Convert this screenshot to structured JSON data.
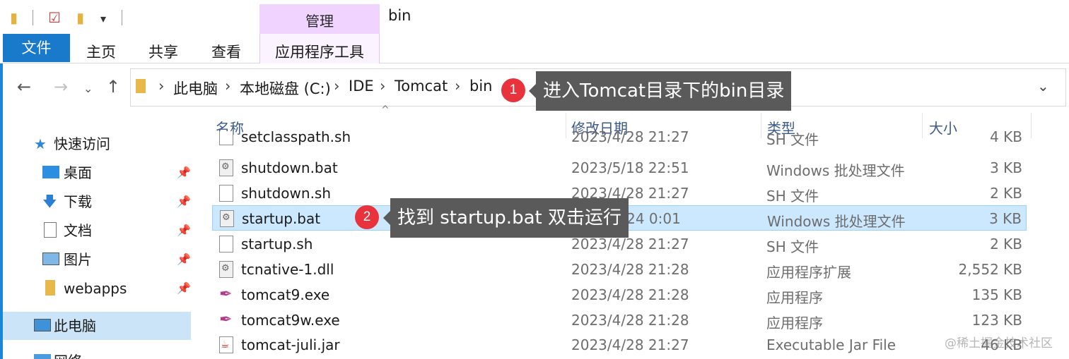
{
  "window": {
    "title": "bin"
  },
  "quick_access_toolbar": {
    "dropdown_glyph": "▾"
  },
  "ribbon": {
    "contextual_group": "管理",
    "tabs": [
      {
        "label": "文件"
      },
      {
        "label": "主页"
      },
      {
        "label": "共享"
      },
      {
        "label": "查看"
      },
      {
        "label": "应用程序工具"
      }
    ]
  },
  "address_bar": {
    "breadcrumbs": [
      "此电脑",
      "本地磁盘 (C:)",
      "IDE",
      "Tomcat",
      "bin"
    ],
    "separator": "›"
  },
  "callouts": [
    {
      "number": "1",
      "text": "进入Tomcat目录下的bin目录"
    },
    {
      "number": "2",
      "text": "找到 startup.bat 双击运行"
    }
  ],
  "columns": {
    "name": "名称",
    "date": "修改日期",
    "type": "类型",
    "size": "大小"
  },
  "sidebar": {
    "items": [
      {
        "label": "快速访问",
        "icon": "star-icon"
      },
      {
        "label": "桌面",
        "icon": "desktop-icon"
      },
      {
        "label": "下载",
        "icon": "download-icon"
      },
      {
        "label": "文档",
        "icon": "document-icon"
      },
      {
        "label": "图片",
        "icon": "pictures-icon"
      },
      {
        "label": "webapps",
        "icon": "folder-icon"
      },
      {
        "label": "此电脑",
        "icon": "computer-icon"
      },
      {
        "label": "网络",
        "icon": "network-icon"
      }
    ]
  },
  "files": [
    {
      "name": "setclasspath.sh",
      "date": "2023/4/28 21:27",
      "type": "SH 文件",
      "size": "4 KB",
      "icon": "doc"
    },
    {
      "name": "shutdown.bat",
      "date": "2023/5/18 22:51",
      "type": "Windows 批处理文件",
      "size": "3 KB",
      "icon": "bat"
    },
    {
      "name": "shutdown.sh",
      "date": "2023/4/28 21:27",
      "type": "SH 文件",
      "size": "2 KB",
      "icon": "doc"
    },
    {
      "name": "startup.bat",
      "date": "2023/5/24 0:01",
      "type": "Windows 批处理文件",
      "size": "3 KB",
      "icon": "bat",
      "selected": true
    },
    {
      "name": "startup.sh",
      "date": "2023/4/28 21:27",
      "type": "SH 文件",
      "size": "2 KB",
      "icon": "doc"
    },
    {
      "name": "tcnative-1.dll",
      "date": "2023/4/28 21:28",
      "type": "应用程序扩展",
      "size": "2,552 KB",
      "icon": "bat"
    },
    {
      "name": "tomcat9.exe",
      "date": "2023/4/28 21:28",
      "type": "应用程序",
      "size": "135 KB",
      "icon": "exe"
    },
    {
      "name": "tomcat9w.exe",
      "date": "2023/4/28 21:28",
      "type": "应用程序",
      "size": "123 KB",
      "icon": "exe"
    },
    {
      "name": "tomcat-juli.jar",
      "date": "2023/4/28 21:27",
      "type": "Executable Jar File",
      "size": "46 KB",
      "icon": "jar"
    }
  ],
  "watermark": "@稀土掘金技术社区"
}
